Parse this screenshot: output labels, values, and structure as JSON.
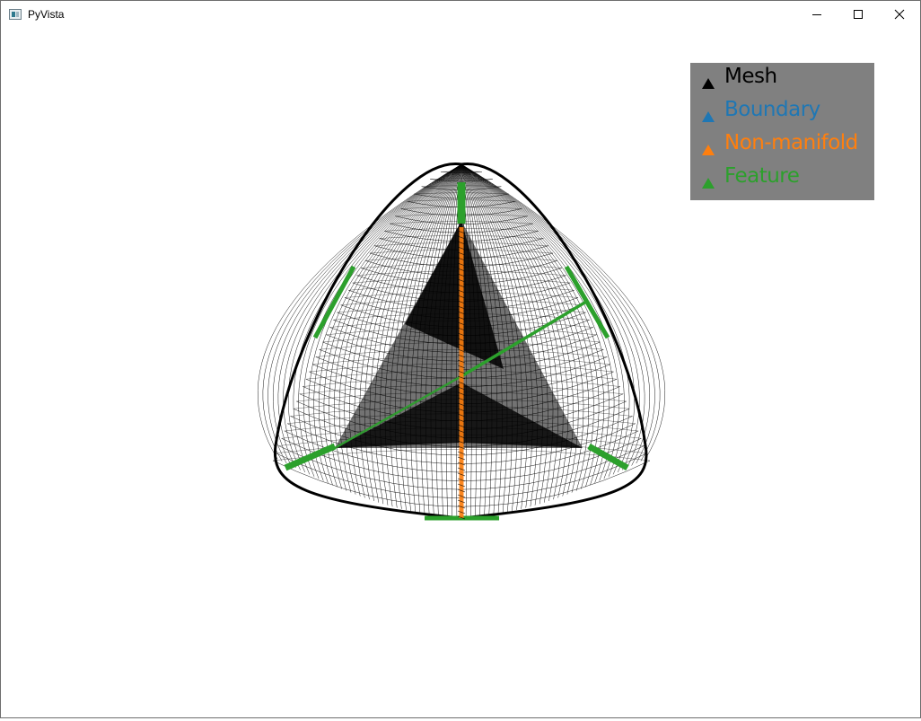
{
  "window": {
    "title": "PyVista",
    "controls": [
      "minimize",
      "maximize",
      "close"
    ]
  },
  "legend": {
    "entries": [
      {
        "label": "Mesh",
        "color": "#000000",
        "icon": "triangle-marker"
      },
      {
        "label": "Boundary",
        "color": "#1f77b4",
        "icon": "triangle-marker"
      },
      {
        "label": "Non-manifold",
        "color": "#ff7f0e",
        "icon": "triangle-marker"
      },
      {
        "label": "Feature",
        "color": "#2ca02c",
        "icon": "triangle-marker"
      }
    ],
    "background": "#808080"
  },
  "scene": {
    "background": "#ffffff",
    "mesh_color": "#000000",
    "non_manifold_color": "#ff7f0e",
    "feature_color": "#2ca02c"
  }
}
